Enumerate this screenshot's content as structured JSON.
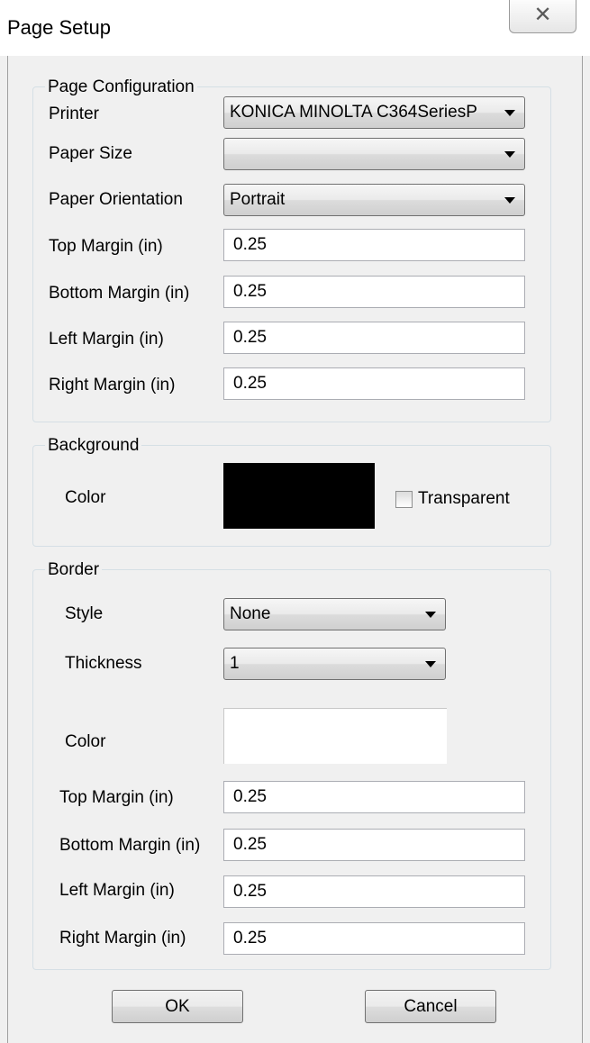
{
  "window": {
    "title": "Page Setup",
    "close_glyph": "✕"
  },
  "page_config": {
    "group_title": "Page Configuration",
    "printer_label": "Printer",
    "printer_value": "KONICA MINOLTA C364SeriesP",
    "paper_size_label": "Paper Size",
    "paper_size_value": "",
    "orientation_label": "Paper Orientation",
    "orientation_value": "Portrait",
    "top_margin_label": "Top Margin (in)",
    "top_margin_value": "0.25",
    "bottom_margin_label": "Bottom Margin (in)",
    "bottom_margin_value": "0.25",
    "left_margin_label": "Left Margin (in)",
    "left_margin_value": "0.25",
    "right_margin_label": "Right Margin (in)",
    "right_margin_value": "0.25"
  },
  "background": {
    "group_title": "Background",
    "color_label": "Color",
    "color_value": "#000000",
    "transparent_label": "Transparent",
    "transparent_checked": false
  },
  "border": {
    "group_title": "Border",
    "style_label": "Style",
    "style_value": "None",
    "thickness_label": "Thickness",
    "thickness_value": "1",
    "color_label": "Color",
    "color_value": "#ffffff",
    "top_margin_label": "Top Margin (in)",
    "top_margin_value": "0.25",
    "bottom_margin_label": "Bottom Margin (in)",
    "bottom_margin_value": "0.25",
    "left_margin_label": "Left Margin (in)",
    "left_margin_value": "0.25",
    "right_margin_label": "Right Margin (in)",
    "right_margin_value": "0.25"
  },
  "buttons": {
    "ok_label": "OK",
    "cancel_label": "Cancel"
  },
  "icons": {
    "close": "close-icon",
    "dropdown": "chevron-down-icon",
    "checkbox": "checkbox-icon"
  }
}
